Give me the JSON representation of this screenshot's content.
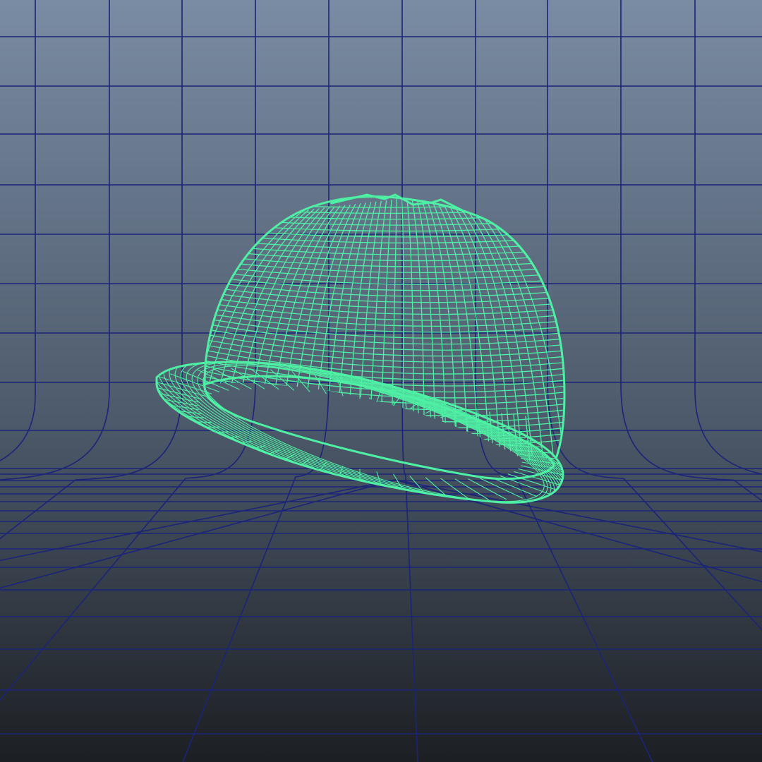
{
  "viewport": {
    "view": "perspective",
    "display_mode": "wireframe",
    "colors": {
      "background_top": "#7a8ca3",
      "background_mid": "#4d5a6b",
      "background_bottom": "#1c1f23",
      "grid": "#1b2478",
      "wireframe": "#4ef0a4"
    }
  },
  "scene": {
    "object": {
      "name": "hard-hat",
      "type": "helmet mesh",
      "selected": true
    },
    "backdrop": {
      "type": "curved infinite backdrop"
    }
  }
}
